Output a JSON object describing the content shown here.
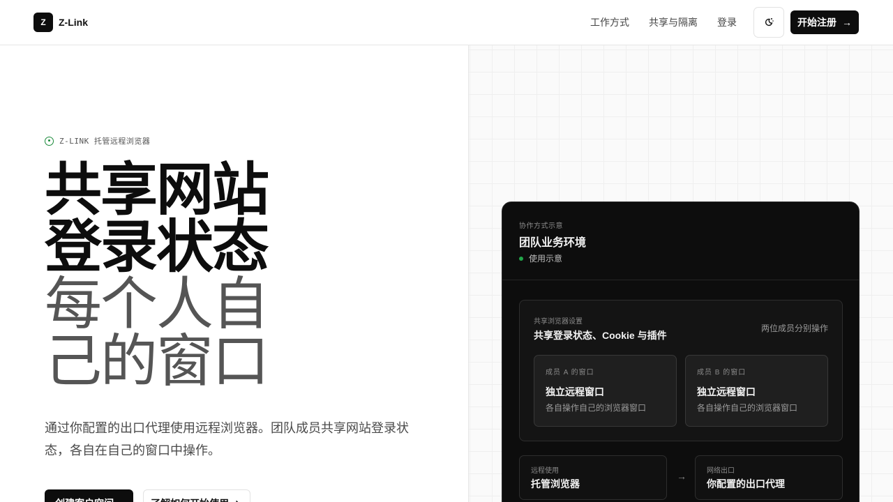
{
  "brand": {
    "mark": "Z",
    "name": "Z-Link"
  },
  "nav": {
    "how_it_works": "工作方式",
    "sharing": "共享与隔离",
    "login": "登录",
    "signup": "开始注册"
  },
  "icons": {
    "theme_toggle": "theme-toggle-icon",
    "arrow": "arrow-right-icon"
  },
  "hero": {
    "eyebrow": "Z-LINK 托管远程浏览器",
    "line1": "共享网站",
    "line2": "登录状态",
    "line3": "每个人自",
    "line4": "己的窗口",
    "description": "通过你配置的出口代理使用远程浏览器。团队成员共享网站登录状态，各自在自己的窗口中操作。",
    "cta_primary": "创建客户空间",
    "cta_secondary": "了解如何开始使用"
  },
  "demo": {
    "kicker": "协作方式示意",
    "title": "团队业务环境",
    "status": "使用示意",
    "shared": {
      "kicker": "共享浏览器设置",
      "title": "共享登录状态、Cookie 与插件",
      "note": "两位成员分别操作",
      "members": [
        {
          "kicker": "成员 A 的窗口",
          "title": "独立远程窗口",
          "sub": "各自操作自己的浏览器窗口"
        },
        {
          "kicker": "成员 B 的窗口",
          "title": "独立远程窗口",
          "sub": "各自操作自己的浏览器窗口"
        }
      ]
    },
    "flow": {
      "left": {
        "kicker": "远程使用",
        "title": "托管浏览器"
      },
      "right": {
        "kicker": "网络出口",
        "title": "你配置的出口代理"
      }
    }
  },
  "colors": {
    "accent_green": "#22a64a",
    "dark": "#0d0d0d",
    "muted_text": "#555555"
  }
}
